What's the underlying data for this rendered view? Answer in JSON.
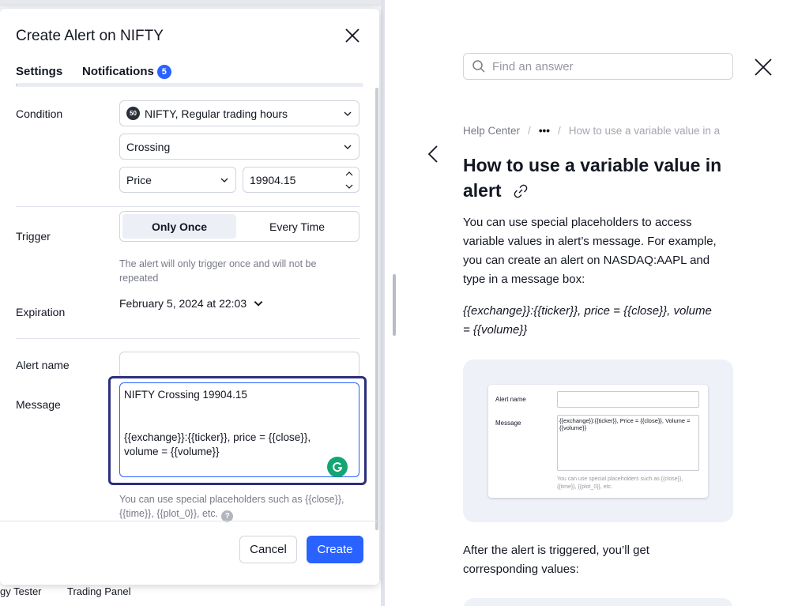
{
  "background": {
    "bottom_tabs": [
      "gy Tester",
      "Trading Panel"
    ]
  },
  "dialog": {
    "title": "Create Alert on NIFTY",
    "tabs": [
      {
        "label": "Settings",
        "active": true
      },
      {
        "label": "Notifications",
        "badge": "5"
      }
    ],
    "condition": {
      "label": "Condition",
      "symbol_badge": "50",
      "symbol": "NIFTY, Regular trading hours",
      "operator": "Crossing",
      "source": "Price",
      "value": "19904.15"
    },
    "trigger": {
      "label": "Trigger",
      "options": [
        "Only Once",
        "Every Time"
      ],
      "selected": "Only Once",
      "hint": "The alert will only trigger once and will not be repeated"
    },
    "expiration": {
      "label": "Expiration",
      "value": "February 5, 2024 at 22:03"
    },
    "alert_name": {
      "label": "Alert name",
      "value": ""
    },
    "message": {
      "label": "Message",
      "value": "NIFTY Crossing 19904.15\n\n\n{{exchange}}:{{ticker}}, price = {{close}},\nvolume = {{volume}}",
      "hint": "You can use special placeholders such as {{close}}, {{time}}, {{plot_0}}, etc."
    },
    "buttons": {
      "cancel": "Cancel",
      "create": "Create"
    }
  },
  "help": {
    "search_placeholder": "Find an answer",
    "breadcrumb": [
      "Help Center",
      "•••",
      "How to use a variable value in a"
    ],
    "title": "How to use a variable value in alert",
    "para1": "You can use special placeholders to access variable values in alert’s message. For example, you can create an alert on NASDAQ:AAPL and type in a message box:",
    "example": "{{exchange}}:{{ticker}}, price = {{close}}, volume = {{volume}}",
    "image": {
      "label_name": "Alert name",
      "label_message": "Message",
      "message_text": "{{exchange}}:{{ticker}}, Price = {{close}}, Volume = {{volume}}",
      "hint": "You can use special placeholders such as {{close}}, {{time}}, {{plot_0}}, etc."
    },
    "para2": "After the alert is triggered, you’ll get corresponding values:"
  },
  "colors": {
    "accent": "#2962ff",
    "focus_ring": "#2d2f7e",
    "grammarly": "#15a474"
  }
}
